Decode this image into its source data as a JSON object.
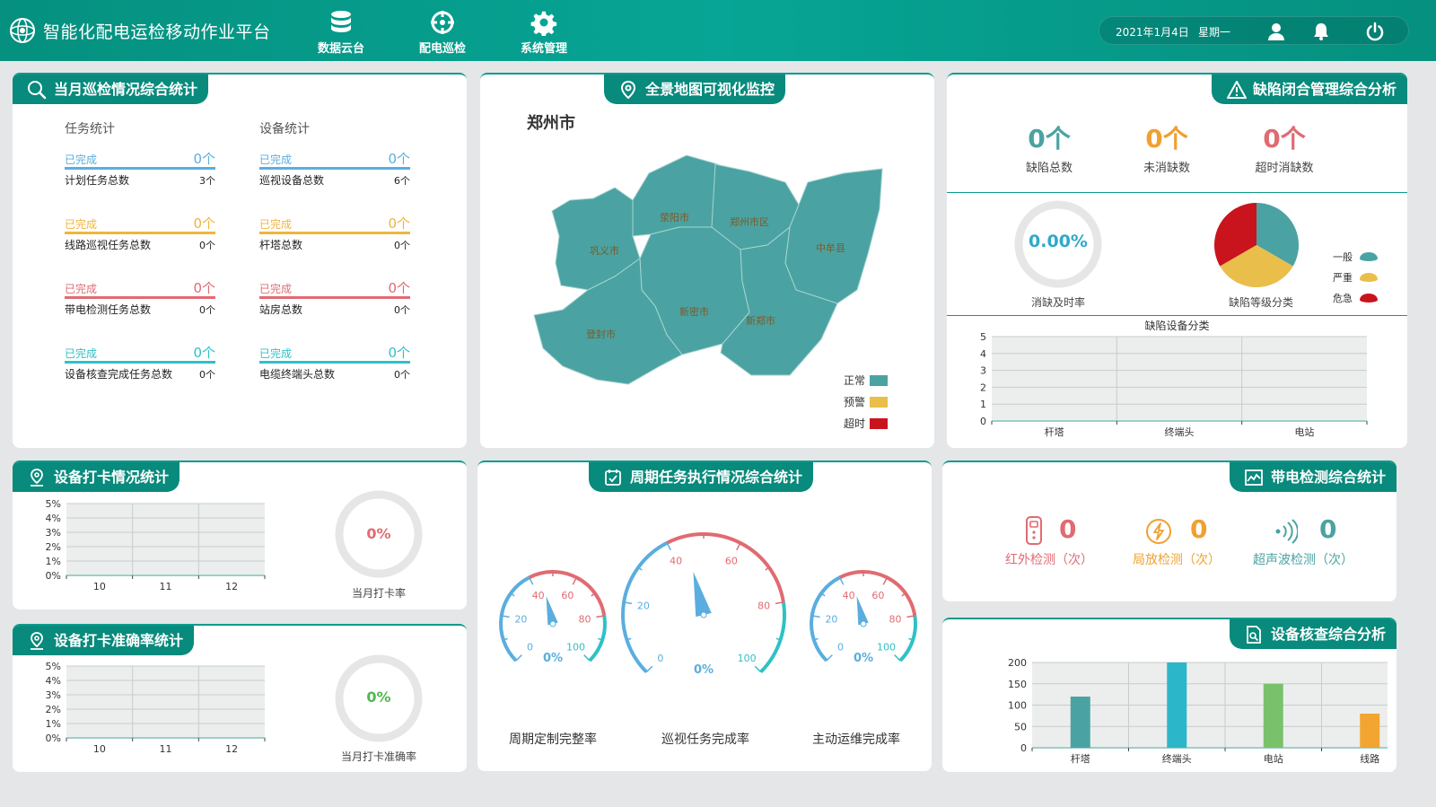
{
  "header": {
    "title": "智能化配电运检移动作业平台",
    "nav": [
      {
        "label": "数据云台",
        "icon": "database-icon"
      },
      {
        "label": "配电巡检",
        "icon": "crosshair-icon"
      },
      {
        "label": "系统管理",
        "icon": "gear-icon"
      }
    ],
    "date": "2021年1月4日",
    "weekday": "星期一",
    "icons": [
      "user-icon",
      "bell-icon",
      "power-icon"
    ]
  },
  "colors": {
    "primary": "#088a7c",
    "blue": "#5aaedf",
    "yellow": "#f0b43c",
    "red": "#e06b72",
    "cyan": "#2fc1c6",
    "map_normal": "#4aa3a2",
    "map_warn": "#e9be4a",
    "map_timeout": "#c9141d"
  },
  "patrol": {
    "title": "当月巡检情况综合统计",
    "task_head": "任务统计",
    "device_head": "设备统计",
    "tasks": [
      {
        "done_label": "已完成",
        "done_count": "0个",
        "name": "计划任务总数",
        "total": "3个",
        "color": "#5aaedf"
      },
      {
        "done_label": "已完成",
        "done_count": "0个",
        "name": "线路巡视任务总数",
        "total": "0个",
        "color": "#f0b43c"
      },
      {
        "done_label": "已完成",
        "done_count": "0个",
        "name": "带电检测任务总数",
        "total": "0个",
        "color": "#e06b72"
      },
      {
        "done_label": "已完成",
        "done_count": "0个",
        "name": "设备核查完成任务总数",
        "total": "0个",
        "color": "#2fc1c6"
      }
    ],
    "devices": [
      {
        "done_label": "已完成",
        "done_count": "0个",
        "name": "巡视设备总数",
        "total": "6个",
        "color": "#5aaedf"
      },
      {
        "done_label": "已完成",
        "done_count": "0个",
        "name": "杆塔总数",
        "total": "0个",
        "color": "#f0b43c"
      },
      {
        "done_label": "已完成",
        "done_count": "0个",
        "name": "站房总数",
        "total": "0个",
        "color": "#e06b72"
      },
      {
        "done_label": "已完成",
        "done_count": "0个",
        "name": "电缆终端头总数",
        "total": "0个",
        "color": "#2fc1c6"
      }
    ]
  },
  "map": {
    "title": "全景地图可视化监控",
    "city": "郑州市",
    "districts": [
      "荥阳市",
      "郑州市区",
      "巩义市",
      "中牟县",
      "新密市",
      "新郑市",
      "登封市"
    ],
    "legend": [
      {
        "label": "正常",
        "color": "#4aa3a2"
      },
      {
        "label": "预警",
        "color": "#e9be4a"
      },
      {
        "label": "超时",
        "color": "#c9141d"
      }
    ]
  },
  "defect": {
    "title": "缺陷闭合管理综合分析",
    "kpis": [
      {
        "value": "0个",
        "label": "缺陷总数",
        "color": "#4aa3a2"
      },
      {
        "value": "0个",
        "label": "未消缺数",
        "color": "#f0a030"
      },
      {
        "value": "0个",
        "label": "超时消缺数",
        "color": "#e06b72"
      }
    ],
    "rate_value": "0.00%",
    "rate_label": "消缺及时率",
    "pie_label": "缺陷等级分类",
    "pie_legend": [
      {
        "label": "一般",
        "color": "#4aa3a2"
      },
      {
        "label": "严重",
        "color": "#e9be4a"
      },
      {
        "label": "危急",
        "color": "#c9141d"
      }
    ]
  },
  "chart_data": [
    {
      "id": "defect-device",
      "type": "bar",
      "title": "缺陷设备分类",
      "categories": [
        "杆塔",
        "终端头",
        "电站"
      ],
      "values": [
        0,
        0,
        0
      ],
      "ylim": [
        0,
        5
      ],
      "yticks": [
        "0",
        "1",
        "2",
        "3",
        "4",
        "5"
      ],
      "grid": true
    },
    {
      "id": "checkin",
      "type": "line",
      "categories": [
        "10",
        "11",
        "12"
      ],
      "values": [
        0,
        0,
        0
      ],
      "ylim": [
        0,
        5
      ],
      "yticks": [
        "0%",
        "1%",
        "2%",
        "3%",
        "4%",
        "5%"
      ],
      "grid": true
    },
    {
      "id": "checkin-accuracy",
      "type": "line",
      "categories": [
        "10",
        "11",
        "12"
      ],
      "values": [
        0,
        0,
        0
      ],
      "ylim": [
        0,
        5
      ],
      "yticks": [
        "0%",
        "1%",
        "2%",
        "3%",
        "4%",
        "5%"
      ],
      "grid": true
    },
    {
      "id": "verify",
      "type": "bar",
      "categories": [
        "杆塔",
        "终端头",
        "电站",
        "线路"
      ],
      "values": [
        120,
        200,
        150,
        80
      ],
      "colors": [
        "#4aa3a2",
        "#2bb7c9",
        "#79c26b",
        "#f2a531"
      ],
      "ylim": [
        0,
        200
      ],
      "yticks": [
        "0",
        "50",
        "100",
        "150",
        "200"
      ],
      "grid": true
    },
    {
      "id": "defect-level-pie",
      "type": "pie",
      "categories": [
        "一般",
        "严重",
        "危急"
      ],
      "values": [
        1,
        1,
        1
      ]
    }
  ],
  "checkin": {
    "title": "设备打卡情况统计",
    "rate": "0%",
    "rate_label": "当月打卡率",
    "accuracy_title": "设备打卡准确率统计",
    "accuracy_rate": "0%",
    "accuracy_label": "当月打卡准确率"
  },
  "cycle": {
    "title": "周期任务执行情况综合统计",
    "gauges": [
      {
        "label": "周期定制完整率",
        "value": "0%",
        "ticks": [
          "0",
          "20",
          "40",
          "60",
          "80",
          "100"
        ]
      },
      {
        "label": "巡视任务完成率",
        "value": "0%",
        "ticks": [
          "0",
          "20",
          "40",
          "60",
          "80",
          "100"
        ]
      },
      {
        "label": "主动运维完成率",
        "value": "0%",
        "ticks": [
          "0",
          "20",
          "40",
          "60",
          "80",
          "100"
        ]
      }
    ]
  },
  "live": {
    "title": "带电检测综合统计",
    "items": [
      {
        "value": "0",
        "label": "红外检测（次）",
        "color": "#e06b72",
        "icon": "infrared-icon"
      },
      {
        "value": "0",
        "label": "局放检测（次）",
        "color": "#f0a030",
        "icon": "lightning-icon"
      },
      {
        "value": "0",
        "label": "超声波检测（次）",
        "color": "#4aa3a2",
        "icon": "ultrasonic-icon"
      }
    ]
  },
  "verify": {
    "title": "设备核查综合分析"
  }
}
